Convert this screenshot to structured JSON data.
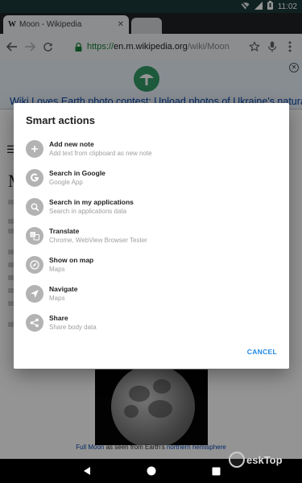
{
  "status_bar": {
    "time": "11:02"
  },
  "browser": {
    "tab_title": "Moon - Wikipedia",
    "tab_favicon": "W",
    "url_scheme": "https://",
    "url_host": "en.m.wikipedia.org",
    "url_path": "/wiki/Moon"
  },
  "page": {
    "banner_text": "Wiki Loves Earth photo contest: Upload photos of Ukraine's natural",
    "heading_initial": "M",
    "caption_link1": "Full Moon",
    "caption_mid": " as seen from Earth's ",
    "caption_link2": "northern hemisphere"
  },
  "dialog": {
    "title": "Smart actions",
    "actions": [
      {
        "title": "Add new note",
        "subtitle": "Add text from clipboard as new note",
        "icon": "plus-icon"
      },
      {
        "title": "Search in Google",
        "subtitle": "Google App",
        "icon": "google-icon"
      },
      {
        "title": "Search in my applications",
        "subtitle": "Search in applications data",
        "icon": "search-icon"
      },
      {
        "title": "Translate",
        "subtitle": "Chrome, WebView Browser Tester",
        "icon": "translate-icon"
      },
      {
        "title": "Show on map",
        "subtitle": "Maps",
        "icon": "compass-icon"
      },
      {
        "title": "Navigate",
        "subtitle": "Maps",
        "icon": "navigation-icon"
      },
      {
        "title": "Share",
        "subtitle": "Share body data",
        "icon": "share-icon"
      }
    ],
    "cancel_label": "CANCEL"
  },
  "watermark": {
    "text": "eskTop"
  },
  "colors": {
    "accent": "#1e88e5",
    "icon_circle": "#b3b3b3",
    "status_bar": "#1d3a3a"
  }
}
